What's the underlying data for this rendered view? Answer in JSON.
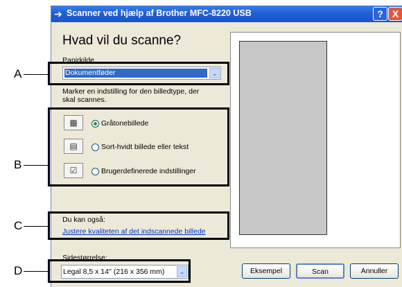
{
  "window": {
    "title": "Scanner ved hjælp af Brother MFC-8220 USB",
    "help_button": "?",
    "close_button": "X"
  },
  "panel": {
    "heading": "Hvad vil du scanne?",
    "paper_source_label": "Papirkilde",
    "paper_source_value": "Dokumentføder",
    "instruction": "Marker en indstilling for den billedtype, der skal scannes.",
    "options": [
      {
        "label": "Gråtonebillede",
        "icon": "grayscale-image-icon",
        "selected": true
      },
      {
        "label": "Sort-hvidt billede eller tekst",
        "icon": "bw-text-icon",
        "selected": false
      },
      {
        "label": "Brugerdefinerede indstillinger",
        "icon": "custom-settings-icon",
        "selected": false
      }
    ],
    "also_label": "Du kan også:",
    "quality_link": "Justere kvaliteten af det indscannede billede",
    "page_size_label": "Sidestørrelse:",
    "page_size_value": "Legal 8,5 x 14'' (216 x 356 mm)"
  },
  "buttons": {
    "example": "Eksempel",
    "scan": "Scan",
    "cancel": "Annuller"
  },
  "callouts": [
    "A",
    "B",
    "C",
    "D"
  ]
}
